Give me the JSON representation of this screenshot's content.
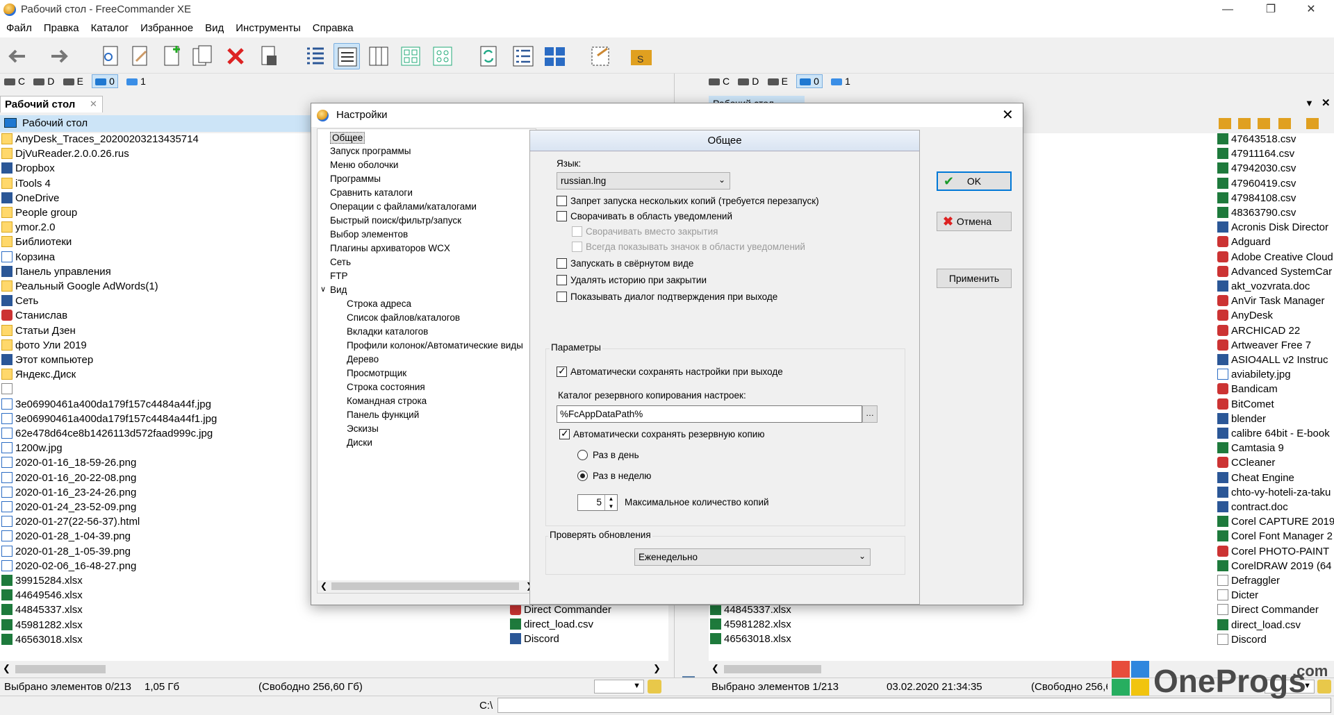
{
  "window": {
    "title": "Рабочий стол - FreeCommander XE"
  },
  "menu": [
    "Файл",
    "Правка",
    "Каталог",
    "Избранное",
    "Вид",
    "Инструменты",
    "Справка"
  ],
  "drives": [
    "C",
    "D",
    "E",
    "0",
    "1"
  ],
  "left_panel": {
    "tab": "Рабочий стол",
    "path": "Рабочий стол",
    "items": [
      {
        "name": "AnyDesk_Traces_20200203213435714",
        "icon": "folder"
      },
      {
        "name": "DjVuReader.2.0.0.26.rus",
        "icon": "folder"
      },
      {
        "name": "Dropbox",
        "icon": "dropbox"
      },
      {
        "name": "iTools 4",
        "icon": "folder"
      },
      {
        "name": "OneDrive",
        "icon": "cloud"
      },
      {
        "name": "People group",
        "icon": "folder"
      },
      {
        "name": "ymor.2.0",
        "icon": "folder"
      },
      {
        "name": "Библиотеки",
        "icon": "folder"
      },
      {
        "name": "Корзина",
        "icon": "recycle"
      },
      {
        "name": "Панель управления",
        "icon": "control"
      },
      {
        "name": "Реальный Google AdWords(1)",
        "icon": "folder"
      },
      {
        "name": "Сеть",
        "icon": "network"
      },
      {
        "name": "Станислав",
        "icon": "user"
      },
      {
        "name": "Статьи Дзен",
        "icon": "folder"
      },
      {
        "name": "фото Ули 2019",
        "icon": "folder"
      },
      {
        "name": "Этот компьютер",
        "icon": "computer"
      },
      {
        "name": "Яндекс.Диск",
        "icon": "folder"
      },
      {
        "name": "",
        "icon": "blank"
      },
      {
        "name": "3e06990461a400da179f157c4484a44f.jpg",
        "icon": "image"
      },
      {
        "name": "3e06990461a400da179f157c4484a44f1.jpg",
        "icon": "image"
      },
      {
        "name": "62e478d64ce8b1426113d572faad999c.jpg",
        "icon": "image"
      },
      {
        "name": "1200w.jpg",
        "icon": "image"
      },
      {
        "name": "2020-01-16_18-59-26.png",
        "icon": "image"
      },
      {
        "name": "2020-01-16_20-22-08.png",
        "icon": "image"
      },
      {
        "name": "2020-01-16_23-24-26.png",
        "icon": "image"
      },
      {
        "name": "2020-01-24_23-52-09.png",
        "icon": "image"
      },
      {
        "name": "2020-01-27(22-56-37).html",
        "icon": "html"
      },
      {
        "name": "2020-01-28_1-04-39.png",
        "icon": "image"
      },
      {
        "name": "2020-01-28_1-05-39.png",
        "icon": "image"
      },
      {
        "name": "2020-02-06_16-48-27.png",
        "icon": "image"
      },
      {
        "name": "39915284.xlsx",
        "icon": "excel"
      },
      {
        "name": "44649546.xlsx",
        "icon": "excel"
      },
      {
        "name": "44845337.xlsx",
        "icon": "excel"
      },
      {
        "name": "45981282.xlsx",
        "icon": "excel"
      },
      {
        "name": "46563018.xlsx",
        "icon": "excel"
      }
    ],
    "second_column": [
      {
        "name": "Direct Commander",
        "icon": "app"
      },
      {
        "name": "direct_load.csv",
        "icon": "excel"
      },
      {
        "name": "Discord",
        "icon": "doc"
      }
    ],
    "status": {
      "selected": "Выбрано элементов 0/213",
      "size": "1,05 Гб",
      "free": "(Свободно 256,60 Гб)"
    }
  },
  "right_panel": {
    "tab": "Рабочий стол",
    "col1": [
      {
        "name": "44845337.xlsx",
        "icon": "excel"
      },
      {
        "name": "45981282.xlsx",
        "icon": "excel"
      },
      {
        "name": "46563018.xlsx",
        "icon": "excel"
      }
    ],
    "col2": [
      {
        "name": "47643518.csv",
        "icon": "excel"
      },
      {
        "name": "47911164.csv",
        "icon": "excel"
      },
      {
        "name": "47942030.csv",
        "icon": "excel"
      },
      {
        "name": "47960419.csv",
        "icon": "excel"
      },
      {
        "name": "47984108.csv",
        "icon": "excel"
      },
      {
        "name": "48363790.csv",
        "icon": "excel"
      },
      {
        "name": "Acronis Disk Director",
        "icon": "doc"
      },
      {
        "name": "Adguard",
        "icon": "app"
      },
      {
        "name": "Adobe Creative Cloud",
        "icon": "app"
      },
      {
        "name": "Advanced SystemCar",
        "icon": "app"
      },
      {
        "name": "akt_vozvrata.doc",
        "icon": "doc"
      },
      {
        "name": "AnVir Task Manager",
        "icon": "app"
      },
      {
        "name": "AnyDesk",
        "icon": "app"
      },
      {
        "name": "ARCHICAD 22",
        "icon": "app"
      },
      {
        "name": "Artweaver Free 7",
        "icon": "app"
      },
      {
        "name": "ASIO4ALL v2 Instruc",
        "icon": "doc"
      },
      {
        "name": "aviabilety.jpg",
        "icon": "image"
      },
      {
        "name": "Bandicam",
        "icon": "app"
      },
      {
        "name": "BitComet",
        "icon": "app"
      },
      {
        "name": "blender",
        "icon": "doc"
      },
      {
        "name": "calibre 64bit - E-book",
        "icon": "doc"
      },
      {
        "name": "Camtasia 9",
        "icon": "excel"
      },
      {
        "name": "CCleaner",
        "icon": "app"
      },
      {
        "name": "Cheat Engine",
        "icon": "doc"
      },
      {
        "name": "chto-vy-hoteli-za-taku",
        "icon": "doc"
      },
      {
        "name": "contract.doc",
        "icon": "doc"
      },
      {
        "name": "Corel CAPTURE 2019",
        "icon": "excel"
      },
      {
        "name": "Corel Font Manager 2",
        "icon": "excel"
      },
      {
        "name": "Corel PHOTO-PAINT",
        "icon": "app"
      },
      {
        "name": "CorelDRAW 2019 (64",
        "icon": "excel"
      },
      {
        "name": "Defraggler",
        "icon": "blank"
      },
      {
        "name": "Dicter",
        "icon": "blank"
      },
      {
        "name": "Direct Commander",
        "icon": "blank"
      },
      {
        "name": "direct_load.csv",
        "icon": "excel"
      },
      {
        "name": "Discord",
        "icon": "blank"
      }
    ],
    "status": {
      "selected": "Выбрано элементов 1/213",
      "date": "03.02.2020 21:34:35",
      "free": "(Свободно 256,6"
    }
  },
  "cmdline": {
    "prompt": "C:\\"
  },
  "dialog": {
    "title": "Настройки",
    "tree": [
      {
        "label": "Общее",
        "level": 0,
        "selected": true
      },
      {
        "label": "Запуск программы",
        "level": 0
      },
      {
        "label": "Меню оболочки",
        "level": 0
      },
      {
        "label": "Программы",
        "level": 0
      },
      {
        "label": "Сравнить каталоги",
        "level": 0
      },
      {
        "label": "Операции с файлами/каталогами",
        "level": 0
      },
      {
        "label": "Быстрый поиск/фильтр/запуск",
        "level": 0
      },
      {
        "label": "Выбор элементов",
        "level": 0
      },
      {
        "label": "Плагины архиваторов WCX",
        "level": 0
      },
      {
        "label": "Сеть",
        "level": 0
      },
      {
        "label": "FTP",
        "level": 0
      },
      {
        "label": "Вид",
        "level": 0,
        "expanded": true
      },
      {
        "label": "Строка адреса",
        "level": 1
      },
      {
        "label": "Список файлов/каталогов",
        "level": 1
      },
      {
        "label": "Вкладки каталогов",
        "level": 1
      },
      {
        "label": "Профили колонок/Автоматические виды",
        "level": 1
      },
      {
        "label": "Дерево",
        "level": 1
      },
      {
        "label": "Просмотрщик",
        "level": 1
      },
      {
        "label": "Строка состояния",
        "level": 1
      },
      {
        "label": "Командная строка",
        "level": 1
      },
      {
        "label": "Панель функций",
        "level": 1
      },
      {
        "label": "Эскизы",
        "level": 1
      },
      {
        "label": "Диски",
        "level": 1
      }
    ],
    "section_title": "Общее",
    "language_label": "Язык:",
    "language_value": "russian.lng",
    "checks": [
      {
        "label": "Запрет запуска нескольких копий (требуется перезапуск)",
        "checked": false,
        "enabled": true
      },
      {
        "label": "Сворачивать в область уведомлений",
        "checked": false,
        "enabled": true
      },
      {
        "label": "Сворачивать вместо закрытия",
        "checked": false,
        "enabled": false
      },
      {
        "label": "Всегда показывать значок в области уведомлений",
        "checked": false,
        "enabled": false
      },
      {
        "label": "Запускать в свёрнутом виде",
        "checked": false,
        "enabled": true
      },
      {
        "label": "Удалять историю при закрытии",
        "checked": false,
        "enabled": true
      },
      {
        "label": "Показывать диалог подтверждения при выходе",
        "checked": false,
        "enabled": true
      }
    ],
    "params_group": "Параметры",
    "autosave_label": "Автоматически сохранять настройки при выходе",
    "backup_dir_label": "Каталог резервного копирования настроек:",
    "backup_dir_value": "%FcAppDataPath%",
    "autobackup_label": "Автоматически сохранять резервную копию",
    "radio_daily": "Раз в день",
    "radio_weekly": "Раз в неделю",
    "max_copies_value": "5",
    "max_copies_label": "Максимальное количество копий",
    "updates_group": "Проверять обновления",
    "updates_value": "Еженедельно",
    "buttons": {
      "ok": "OK",
      "cancel": "Отмена",
      "apply": "Применить"
    }
  },
  "watermark": {
    "text": "OneProgs",
    "suffix": ".com"
  }
}
